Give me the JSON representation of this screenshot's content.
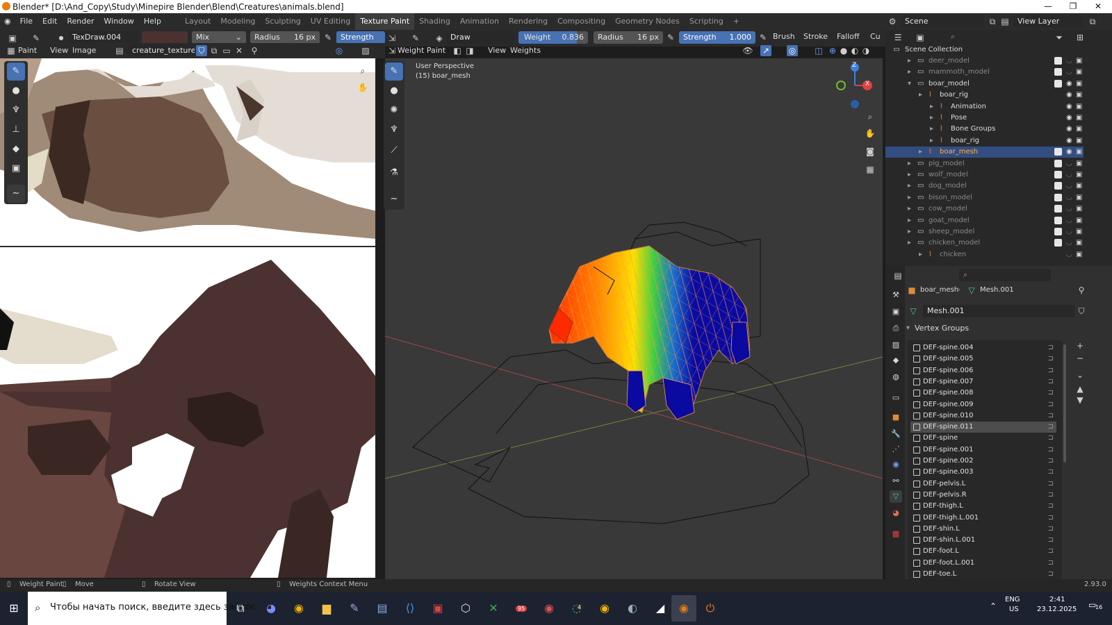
{
  "titlebar": {
    "title": "Blender* [D:\\And_Copy\\Study\\Minepire Blender\\Blend\\Creatures\\animals.blend]"
  },
  "menu": {
    "items": [
      "File",
      "Edit",
      "Render",
      "Window",
      "Help"
    ],
    "workspaces": [
      "Layout",
      "Modeling",
      "Sculpting",
      "UV Editing",
      "Texture Paint",
      "Shading",
      "Animation",
      "Rendering",
      "Compositing",
      "Geometry Nodes",
      "Scripting"
    ],
    "active_workspace": "Texture Paint",
    "add_tab": "+",
    "scene": "Scene",
    "view_layer": "View Layer"
  },
  "image_editor": {
    "brush_name": "TexDraw.004",
    "blend_mode": "Mix",
    "radius_label": "Radius",
    "radius_value": "16 px",
    "strength_label": "Strength",
    "mode": "Paint",
    "view_menu": "View",
    "image_menu": "Image",
    "image_name": "creature_texture.png",
    "brush_color": "#4b3230"
  },
  "viewport": {
    "brush_name": "Draw",
    "weight_label": "Weight",
    "weight_value": "0.836",
    "weight_fill": 0.836,
    "radius_label": "Radius",
    "radius_value": "16 px",
    "strength_label": "Strength",
    "strength_value": "1.000",
    "brush_menu": "Brush",
    "stroke_menu": "Stroke",
    "falloff_menu": "Falloff",
    "cu_menu": "Cu",
    "mode": "Weight Paint",
    "view_menu": "View",
    "weights_menu": "Weights",
    "overlay_line1": "User Perspective",
    "overlay_line2": "(15) boar_mesh",
    "gizmo_x": "X",
    "gizmo_z": "Z"
  },
  "outliner": {
    "root": "Scene Collection",
    "rows": [
      {
        "label": "deer_model",
        "indent": 1,
        "dim": true
      },
      {
        "label": "mammoth_model",
        "indent": 1,
        "dim": true
      },
      {
        "label": "boar_model",
        "indent": 1,
        "dim": false
      },
      {
        "label": "boar_rig",
        "indent": 2,
        "dim": false
      },
      {
        "label": "Animation",
        "indent": 3,
        "dim": false
      },
      {
        "label": "Pose",
        "indent": 3,
        "dim": false
      },
      {
        "label": "Bone Groups",
        "indent": 3,
        "dim": false
      },
      {
        "label": "boar_rig",
        "indent": 3,
        "dim": false
      },
      {
        "label": "boar_mesh",
        "indent": 2,
        "dim": false,
        "selected": true
      },
      {
        "label": "pig_model",
        "indent": 1,
        "dim": true
      },
      {
        "label": "wolf_model",
        "indent": 1,
        "dim": true
      },
      {
        "label": "dog_model",
        "indent": 1,
        "dim": true
      },
      {
        "label": "bison_model",
        "indent": 1,
        "dim": true
      },
      {
        "label": "cow_model",
        "indent": 1,
        "dim": true
      },
      {
        "label": "goat_model",
        "indent": 1,
        "dim": true
      },
      {
        "label": "sheep_model",
        "indent": 1,
        "dim": true
      },
      {
        "label": "chicken_model",
        "indent": 1,
        "dim": true
      },
      {
        "label": "chicken",
        "indent": 2,
        "dim": true
      }
    ]
  },
  "properties": {
    "object_name": "boar_mesh",
    "mesh_name": "Mesh.001",
    "mesh_data_field": "Mesh.001",
    "panel_title": "Vertex Groups",
    "vertex_groups": [
      "DEF-spine.004",
      "DEF-spine.005",
      "DEF-spine.006",
      "DEF-spine.007",
      "DEF-spine.008",
      "DEF-spine.009",
      "DEF-spine.010",
      "DEF-spine.011",
      "DEF-spine",
      "DEF-spine.001",
      "DEF-spine.002",
      "DEF-spine.003",
      "DEF-pelvis.L",
      "DEF-pelvis.R",
      "DEF-thigh.L",
      "DEF-thigh.L.001",
      "DEF-shin.L",
      "DEF-shin.L.001",
      "DEF-foot.L",
      "DEF-foot.L.001",
      "DEF-toe.L"
    ],
    "selected_group": "DEF-spine.011"
  },
  "statusbar": {
    "hint1": "Weight Paint",
    "hint2": "Move",
    "hint3": "Rotate View",
    "hint4": "Weights Context Menu",
    "version": "2.93.0"
  },
  "taskbar": {
    "search_placeholder": "Чтобы начать поиск, введите здесь запрос",
    "lang": "ENG",
    "region": "US",
    "time": "2:41",
    "date": "23.12.2025",
    "notif_count": "16",
    "badge_a": "4",
    "badge_b": "95"
  },
  "colors": {
    "accent": "#4772b3",
    "selected_row": "#334d80",
    "bg_panel": "#303030",
    "viewport_bg": "#393939",
    "texture_brown": "#4b3230"
  }
}
